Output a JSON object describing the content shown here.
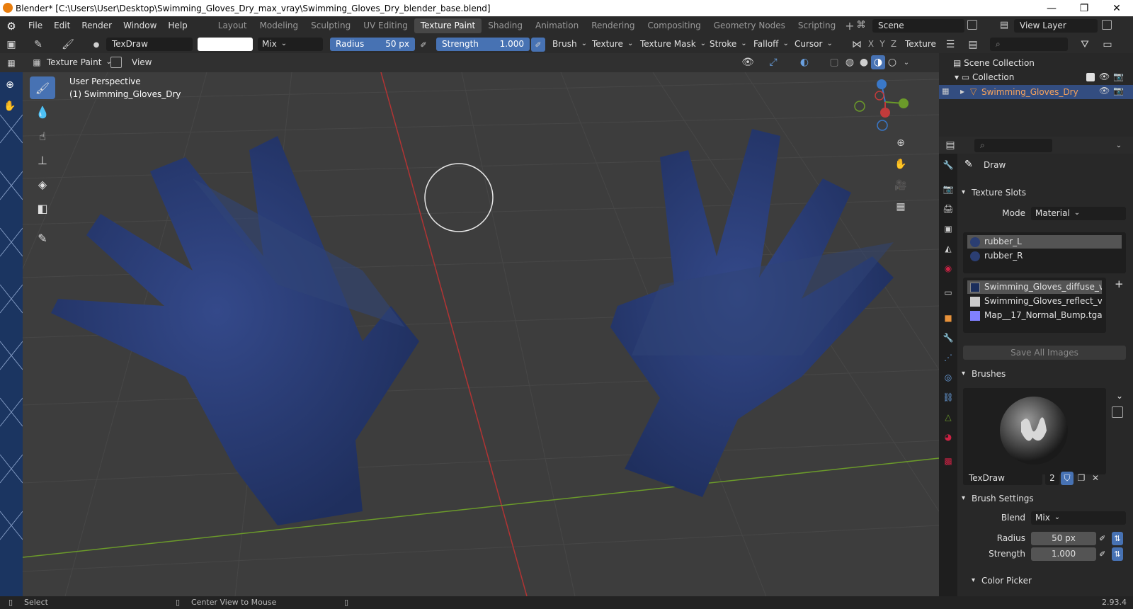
{
  "window": {
    "title": "Blender* [C:\\Users\\User\\Desktop\\Swimming_Gloves_Dry_max_vray\\Swimming_Gloves_Dry_blender_base.blend]"
  },
  "menus": [
    "File",
    "Edit",
    "Render",
    "Window",
    "Help"
  ],
  "workspaces": [
    "Layout",
    "Modeling",
    "Sculpting",
    "UV Editing",
    "Texture Paint",
    "Shading",
    "Animation",
    "Rendering",
    "Compositing",
    "Geometry Nodes",
    "Scripting"
  ],
  "scene": "Scene",
  "view_layer": "View Layer",
  "tool_header": {
    "brush_name": "TexDraw",
    "blend": "Mix",
    "radius_label": "Radius",
    "radius_value": "50 px",
    "strength_label": "Strength",
    "strength_value": "1.000",
    "menus": [
      "Brush",
      "Texture",
      "Texture Mask",
      "Stroke",
      "Falloff",
      "Cursor"
    ],
    "axes": [
      "X",
      "Y",
      "Z"
    ],
    "texture_label": "Texture"
  },
  "view_header": {
    "mode": "Texture Paint",
    "view": "View"
  },
  "viewport": {
    "perspective": "User Perspective",
    "object": "(1) Swimming_Gloves_Dry"
  },
  "outliner": {
    "root": "Scene Collection",
    "collection": "Collection",
    "object": "Swimming_Gloves_Dry"
  },
  "properties": {
    "tool_name": "Draw",
    "texture_slots": {
      "title": "Texture Slots",
      "mode_label": "Mode",
      "mode_value": "Material",
      "materials": [
        "rubber_L",
        "rubber_R"
      ],
      "images": [
        "Swimming_Gloves_diffuse_v_a...",
        "Swimming_Gloves_reflect_v_a...",
        "Map__17_Normal_Bump.tga"
      ],
      "save_all": "Save All Images"
    },
    "brushes": {
      "title": "Brushes",
      "brush_name": "TexDraw",
      "users": "2"
    },
    "brush_settings": {
      "title": "Brush Settings",
      "blend_label": "Blend",
      "blend_value": "Mix",
      "radius_label": "Radius",
      "radius_value": "50 px",
      "strength_label": "Strength",
      "strength_value": "1.000"
    },
    "color_picker": "Color Picker"
  },
  "status": {
    "left": "Select",
    "middle": "Center View to Mouse",
    "version": "2.93.4"
  },
  "colors": {
    "accent": "#4772b3",
    "glove": "#2b3e72",
    "x_axis": "#c23b3b",
    "y_axis": "#6b9a2a",
    "viewport_bg": "#3d3d3d"
  }
}
